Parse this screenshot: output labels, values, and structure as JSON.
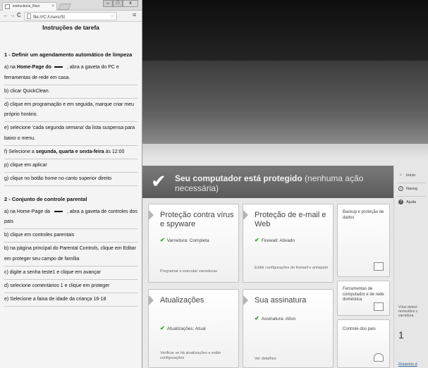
{
  "browser": {
    "tab_title": "instructions_Ravi",
    "tab_close": "×",
    "window_controls": {
      "minimize": "–",
      "maximize": "□",
      "close": "x"
    },
    "url": "file:///C:/Users/St",
    "back": "←",
    "forward": "→",
    "reload": "C",
    "bookmark_star": "☆",
    "menu": "≡"
  },
  "document": {
    "title": "Instruções de tarefa",
    "section1_title": "1 - Definir um agendamento automático de limpeza",
    "section1_steps": [
      {
        "pre": "a) na ",
        "bold": "Home-Page do",
        "post": " , abra a gaveta do PC e ferramentas de rede em casa."
      },
      {
        "text": "b) clicar QuickClean."
      },
      {
        "text": "d) clique em programação e em seguida, marque criar meu próprio horário."
      },
      {
        "text": "e) selecione 'cada segunda semana' da lista suspensa para baixo o menu."
      },
      {
        "pre": "f) Selecione a ",
        "bold": "segunda, quarta e sexta-feira",
        "post": " às 12:00"
      },
      {
        "text": "p) clique em aplicar"
      },
      {
        "text": "g) clique no botão home no canto superior direito"
      }
    ],
    "section2_title": "2 - Conjunto de controle parental",
    "section2_steps": [
      {
        "pre": "a) na Home-Page da ",
        "post": " , abra a gaveta de controles dos pais"
      },
      {
        "text": "b) clique em controles parentais"
      },
      {
        "text": "b) na página principal do Parental Controls, clique em Editar em proteger seu campo de família"
      },
      {
        "text": "c) digite a senha teste1 e clique em avançar"
      },
      {
        "text": "d) selecione comentários 1 e clique em proteger"
      },
      {
        "text": "e) Selecione a faixa de idade da criança 16-18"
      }
    ]
  },
  "app": {
    "status": {
      "check_icon": "✔",
      "bold": "Seu computador está protegido",
      "light": " (nenhuma ação necessária)"
    },
    "nav": {
      "inicio": "Início",
      "navegacao": "Naveg",
      "ajuda": "Ajuda"
    },
    "side_info": {
      "virus_note": "Vírus detect removidos v varredura",
      "count": "1",
      "report_link": "Relatório d"
    },
    "tiles": {
      "virus": {
        "title": "Proteção contra vírus e spyware",
        "status": "Varredura: Completa",
        "link": "Programar e executar varreduras"
      },
      "email": {
        "title": "Proteção de e-mail e Web",
        "status": "Firewall: Ativado",
        "link": "Exibir configurações de firewall e antispam"
      },
      "updates": {
        "title": "Atualizações",
        "status": "Atualizações: Atual",
        "link": "Verificar se há atualizações e exibir configurações"
      },
      "subscription": {
        "title": "Sua assinatura",
        "status": "Assinatura: Ativo",
        "link": "Ver detalhes"
      }
    },
    "small_tiles": {
      "backup": "Backup e proteção de dados",
      "network": "Ferramentas de computador e de rede doméstica",
      "parental": "Controle dos pais"
    }
  }
}
